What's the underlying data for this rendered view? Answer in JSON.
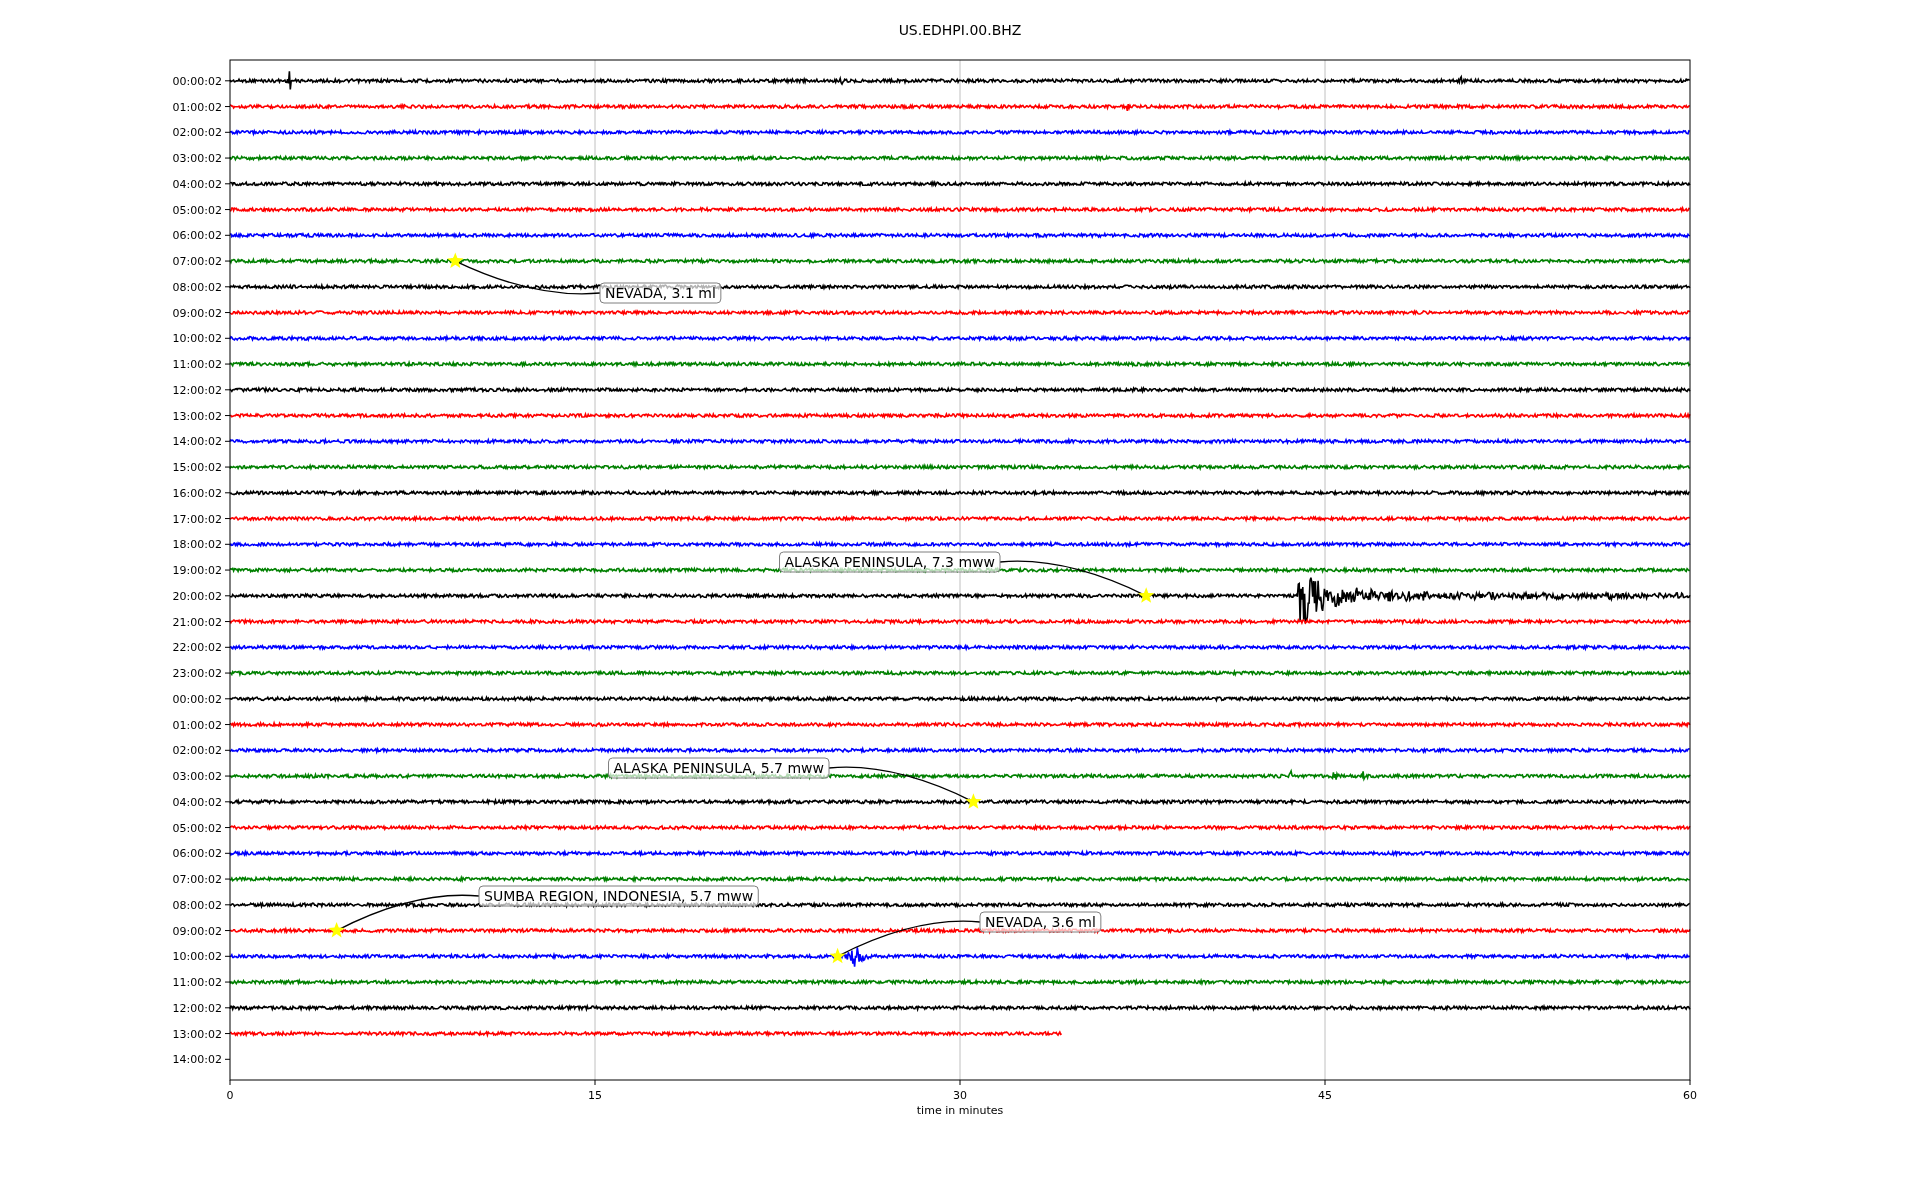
{
  "title": "US.EDHPI.00.BHZ",
  "xlabel": "time in minutes",
  "xticks": [
    "0",
    "15",
    "30",
    "45",
    "60"
  ],
  "rows": [
    {
      "label": "00:00:02",
      "color": "#000000"
    },
    {
      "label": "01:00:02",
      "color": "#ff0000"
    },
    {
      "label": "02:00:02",
      "color": "#0000ff"
    },
    {
      "label": "03:00:02",
      "color": "#008000"
    },
    {
      "label": "04:00:02",
      "color": "#000000"
    },
    {
      "label": "05:00:02",
      "color": "#ff0000"
    },
    {
      "label": "06:00:02",
      "color": "#0000ff"
    },
    {
      "label": "07:00:02",
      "color": "#008000"
    },
    {
      "label": "08:00:02",
      "color": "#000000"
    },
    {
      "label": "09:00:02",
      "color": "#ff0000"
    },
    {
      "label": "10:00:02",
      "color": "#0000ff"
    },
    {
      "label": "11:00:02",
      "color": "#008000"
    },
    {
      "label": "12:00:02",
      "color": "#000000"
    },
    {
      "label": "13:00:02",
      "color": "#ff0000"
    },
    {
      "label": "14:00:02",
      "color": "#0000ff"
    },
    {
      "label": "15:00:02",
      "color": "#008000"
    },
    {
      "label": "16:00:02",
      "color": "#000000"
    },
    {
      "label": "17:00:02",
      "color": "#ff0000"
    },
    {
      "label": "18:00:02",
      "color": "#0000ff"
    },
    {
      "label": "19:00:02",
      "color": "#008000"
    },
    {
      "label": "20:00:02",
      "color": "#000000"
    },
    {
      "label": "21:00:02",
      "color": "#ff0000"
    },
    {
      "label": "22:00:02",
      "color": "#0000ff"
    },
    {
      "label": "23:00:02",
      "color": "#008000"
    },
    {
      "label": "00:00:02",
      "color": "#000000"
    },
    {
      "label": "01:00:02",
      "color": "#ff0000"
    },
    {
      "label": "02:00:02",
      "color": "#0000ff"
    },
    {
      "label": "03:00:02",
      "color": "#008000"
    },
    {
      "label": "04:00:02",
      "color": "#000000"
    },
    {
      "label": "05:00:02",
      "color": "#ff0000"
    },
    {
      "label": "06:00:02",
      "color": "#0000ff"
    },
    {
      "label": "07:00:02",
      "color": "#008000"
    },
    {
      "label": "08:00:02",
      "color": "#000000"
    },
    {
      "label": "09:00:02",
      "color": "#ff0000"
    },
    {
      "label": "10:00:02",
      "color": "#0000ff"
    },
    {
      "label": "11:00:02",
      "color": "#008000"
    },
    {
      "label": "12:00:02",
      "color": "#000000"
    },
    {
      "label": "13:00:02",
      "color": "#ff0000"
    },
    {
      "label": "14:00:02"
    }
  ],
  "events": [
    {
      "label": "NEVADA, 3.1 ml"
    },
    {
      "label": "ALASKA PENINSULA, 7.3 mww"
    },
    {
      "label": "ALASKA PENINSULA, 5.7 mww"
    },
    {
      "label": "SUMBA REGION, INDONESIA, 5.7 mww"
    },
    {
      "label": "NEVADA, 3.6 ml"
    }
  ]
}
